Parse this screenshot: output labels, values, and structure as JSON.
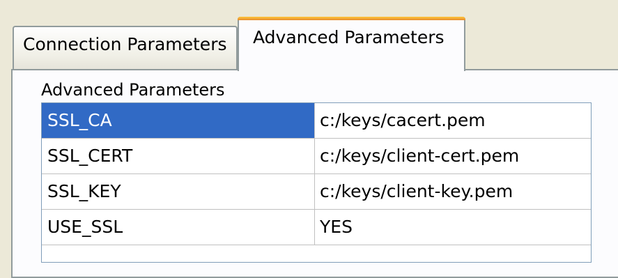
{
  "tabs": [
    {
      "label": "Connection Parameters",
      "active": false
    },
    {
      "label": "Advanced Parameters",
      "active": true
    }
  ],
  "panel": {
    "group_label": "Advanced Parameters",
    "rows": [
      {
        "key": "SSL_CA",
        "value": "c:/keys/cacert.pem",
        "selected": true
      },
      {
        "key": "SSL_CERT",
        "value": "c:/keys/client-cert.pem",
        "selected": false
      },
      {
        "key": "SSL_KEY",
        "value": "c:/keys/client-key.pem",
        "selected": false
      },
      {
        "key": "USE_SSL",
        "value": "YES",
        "selected": false
      }
    ]
  },
  "colors": {
    "selection": "#316ac5",
    "tab_highlight": "#ffc73c",
    "border": "#919b9c",
    "background": "#ece9d8"
  }
}
